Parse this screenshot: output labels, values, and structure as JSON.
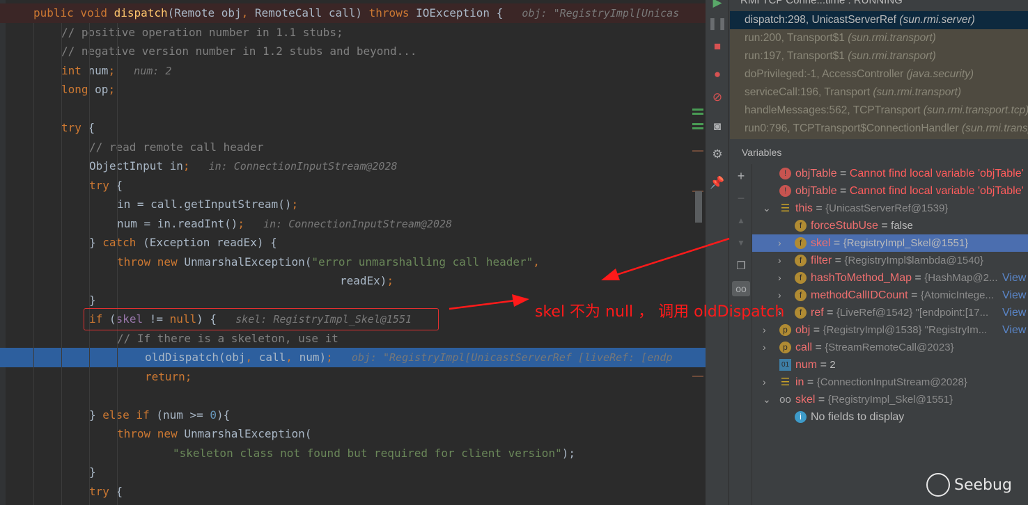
{
  "editor": {
    "lines": [
      {
        "indent": 0,
        "style": "method",
        "tokens": [
          [
            "public void ",
            "kw"
          ],
          [
            "dispatch",
            "fn"
          ],
          [
            "(Remote obj",
            ""
          ],
          [
            ", ",
            "kw"
          ],
          [
            "RemoteCall call) ",
            ""
          ],
          [
            "throws ",
            "kw"
          ],
          [
            "IOException {",
            ""
          ],
          [
            "   obj: \"RegistryImpl[Unicas",
            "hint"
          ]
        ]
      },
      {
        "indent": 1,
        "tokens": [
          [
            "// positive operation number in 1.1 stubs;",
            "cm"
          ]
        ]
      },
      {
        "indent": 1,
        "tokens": [
          [
            "// negative version number in 1.2 stubs and beyond...",
            "cm"
          ]
        ]
      },
      {
        "indent": 1,
        "tokens": [
          [
            "int ",
            "kw"
          ],
          [
            "num",
            ""
          ],
          [
            ";",
            "kw"
          ],
          [
            "   num: 2",
            "hint"
          ]
        ]
      },
      {
        "indent": 1,
        "tokens": [
          [
            "long ",
            "kw"
          ],
          [
            "op",
            ""
          ],
          [
            ";",
            "kw"
          ]
        ]
      },
      {
        "indent": 0,
        "tokens": []
      },
      {
        "indent": 1,
        "tokens": [
          [
            "try ",
            "kw"
          ],
          [
            "{",
            ""
          ]
        ]
      },
      {
        "indent": 2,
        "tokens": [
          [
            "// read remote call header",
            "cm"
          ]
        ]
      },
      {
        "indent": 2,
        "tokens": [
          [
            "ObjectInput in",
            ""
          ],
          [
            ";",
            "kw"
          ],
          [
            "   in: ConnectionInputStream@2028",
            "hint"
          ]
        ]
      },
      {
        "indent": 2,
        "tokens": [
          [
            "try ",
            "kw"
          ],
          [
            "{",
            ""
          ]
        ]
      },
      {
        "indent": 3,
        "tokens": [
          [
            "in = call.getInputStream()",
            ""
          ],
          [
            ";",
            "kw"
          ]
        ]
      },
      {
        "indent": 3,
        "tokens": [
          [
            "num = in.readInt()",
            ""
          ],
          [
            ";",
            "kw"
          ],
          [
            "   in: ConnectionInputStream@2028",
            "hint"
          ]
        ]
      },
      {
        "indent": 2,
        "tokens": [
          [
            "} ",
            ""
          ],
          [
            "catch ",
            "kw"
          ],
          [
            "(Exception readEx) {",
            ""
          ]
        ]
      },
      {
        "indent": 3,
        "tokens": [
          [
            "throw new ",
            "kw"
          ],
          [
            "UnmarshalException(",
            ""
          ],
          [
            "\"error unmarshalling call header\"",
            "str"
          ],
          [
            ",",
            "kw"
          ]
        ]
      },
      {
        "indent": 11,
        "tokens": [
          [
            "readEx)",
            ""
          ],
          [
            ";",
            "kw"
          ]
        ]
      },
      {
        "indent": 2,
        "tokens": [
          [
            "}",
            ""
          ]
        ]
      },
      {
        "indent": 2,
        "tokens": [
          [
            "if ",
            "kw"
          ],
          [
            "(",
            ""
          ],
          [
            "skel",
            "var"
          ],
          [
            " != ",
            ""
          ],
          [
            "null",
            "kw"
          ],
          [
            ") {",
            ""
          ],
          [
            "   skel: RegistryImpl_Skel@1551",
            "hint"
          ]
        ]
      },
      {
        "indent": 3,
        "tokens": [
          [
            "// If there is a skeleton, use it",
            "cm"
          ]
        ]
      },
      {
        "indent": 4,
        "style": "exec",
        "tokens": [
          [
            "oldDispatch(obj",
            ""
          ],
          [
            ", ",
            "kw"
          ],
          [
            "call",
            ""
          ],
          [
            ", ",
            "kw"
          ],
          [
            "num)",
            ""
          ],
          [
            ";",
            "kw"
          ],
          [
            "   obj: \"RegistryImpl[UnicastServerRef [liveRef: [endp",
            "hint"
          ]
        ]
      },
      {
        "indent": 4,
        "tokens": [
          [
            "return",
            "kw"
          ],
          [
            ";",
            "kw"
          ]
        ]
      },
      {
        "indent": 0,
        "tokens": []
      },
      {
        "indent": 2,
        "tokens": [
          [
            "} ",
            ""
          ],
          [
            "else if ",
            "kw"
          ],
          [
            "(num >= ",
            ""
          ],
          [
            "0",
            "num"
          ],
          [
            "){",
            ""
          ]
        ]
      },
      {
        "indent": 3,
        "tokens": [
          [
            "throw new ",
            "kw"
          ],
          [
            "UnmarshalException(",
            ""
          ]
        ]
      },
      {
        "indent": 5,
        "tokens": [
          [
            "\"skeleton class not found but required for client version\"",
            "str"
          ],
          [
            ");",
            ""
          ]
        ]
      },
      {
        "indent": 2,
        "tokens": [
          [
            "}",
            ""
          ]
        ]
      },
      {
        "indent": 2,
        "tokens": [
          [
            "try ",
            "kw"
          ],
          [
            "{",
            ""
          ]
        ]
      }
    ]
  },
  "debugger": {
    "session_title": "RMI TCP Conne...time : RUNNING",
    "frames": [
      {
        "method": "dispatch:298, UnicastServerRef",
        "pkg": "(sun.rmi.server)",
        "selected": true
      },
      {
        "method": "run:200, Transport$1",
        "pkg": "(sun.rmi.transport)"
      },
      {
        "method": "run:197, Transport$1",
        "pkg": "(sun.rmi.transport)"
      },
      {
        "method": "doPrivileged:-1, AccessController",
        "pkg": "(java.security)"
      },
      {
        "method": "serviceCall:196, Transport",
        "pkg": "(sun.rmi.transport)"
      },
      {
        "method": "handleMessages:562, TCPTransport",
        "pkg": "(sun.rmi.transport.tcp)"
      },
      {
        "method": "run0:796, TCPTransport$ConnectionHandler",
        "pkg": "(sun.rmi.transport.tcp)"
      }
    ],
    "variables_label": "Variables",
    "variables": [
      {
        "level": 0,
        "icon": "error",
        "name": "objTable",
        "eq": " = ",
        "value": "Cannot find local variable 'objTable'",
        "vclass": "err"
      },
      {
        "level": 0,
        "icon": "error",
        "name": "objTable",
        "eq": " = ",
        "value": "Cannot find local variable 'objTable'",
        "vclass": "err"
      },
      {
        "level": 0,
        "icon": "object",
        "chev": "⌄",
        "name": "this",
        "eq": " = ",
        "value": "{UnicastServerRef@1539}",
        "vclass": "gr"
      },
      {
        "level": 1,
        "icon": "field",
        "name": "forceStubUse",
        "eq": " = ",
        "value": "false",
        "vclass": ""
      },
      {
        "level": 1,
        "icon": "field",
        "chev": "›",
        "name": "skel",
        "eq": " = ",
        "value": "{RegistryImpl_Skel@1551}",
        "vclass": "",
        "selected": true
      },
      {
        "level": 1,
        "icon": "field",
        "chev": "›",
        "name": "filter",
        "eq": " = ",
        "value": "{RegistryImpl$lambda@1540}",
        "vclass": "gr"
      },
      {
        "level": 1,
        "icon": "field",
        "chev": "›",
        "name": "hashToMethod_Map",
        "eq": " = ",
        "value": "{HashMap@2...",
        "vclass": "gr",
        "link": "View"
      },
      {
        "level": 1,
        "icon": "field",
        "chev": "›",
        "name": "methodCallIDCount",
        "eq": " = ",
        "value": "{AtomicIntege...",
        "vclass": "gr",
        "link": "View"
      },
      {
        "level": 1,
        "icon": "field",
        "chev": "›",
        "name": "ref",
        "eq": " = ",
        "value": "{LiveRef@1542} \"[endpoint:[17...",
        "vclass": "gr",
        "link": "View"
      },
      {
        "level": 0,
        "icon": "param",
        "chev": "›",
        "name": "obj",
        "eq": " = ",
        "value": "{RegistryImpl@1538} \"RegistryIm...",
        "vclass": "gr",
        "link": "View"
      },
      {
        "level": 0,
        "icon": "param",
        "chev": "›",
        "name": "call",
        "eq": " = ",
        "value": "{StreamRemoteCall@2023}",
        "vclass": "gr"
      },
      {
        "level": 0,
        "icon": "primitive",
        "name": "num",
        "eq": " = ",
        "value": "2",
        "vclass": ""
      },
      {
        "level": 0,
        "icon": "object",
        "chev": "›",
        "name": "in",
        "eq": " = ",
        "value": "{ConnectionInputStream@2028}",
        "vclass": "gr"
      },
      {
        "level": 0,
        "icon": "watch",
        "chev": "⌄",
        "name": "skel",
        "eq": " = ",
        "value": "{RegistryImpl_Skel@1551}",
        "vclass": "gr"
      },
      {
        "level": 1,
        "icon": "info",
        "name": "No fields to display",
        "eq": "",
        "value": "",
        "vclass": "",
        "plain": true
      }
    ]
  },
  "annotation": {
    "text": "skel 不为 null ， 调用 oldDispatch",
    "color": "#ff1a1a"
  },
  "watermark": "Seebug"
}
